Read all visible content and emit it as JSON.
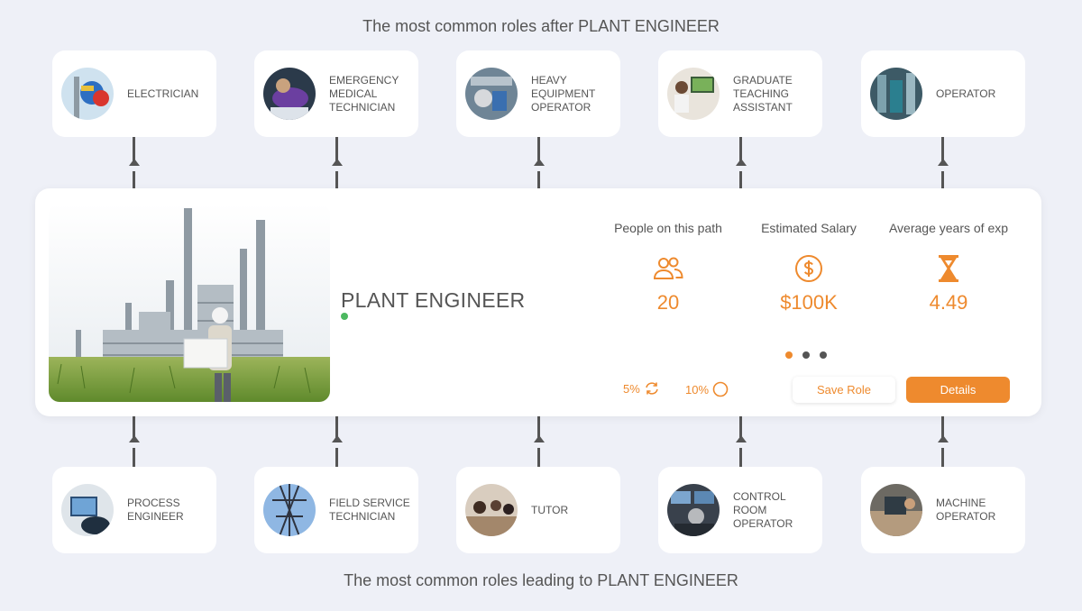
{
  "headings": {
    "after": "The most common roles after PLANT ENGINEER",
    "before": "The most common roles leading to PLANT ENGINEER"
  },
  "roles_after": [
    {
      "label": "ELECTRICIAN",
      "icon": "electrician-photo"
    },
    {
      "label": "EMERGENCY\nMEDICAL\nTECHNICIAN",
      "icon": "emt-photo"
    },
    {
      "label": "HEAVY\nEQUIPMENT\nOPERATOR",
      "icon": "heavy-equipment-photo"
    },
    {
      "label": "GRADUATE\nTEACHING\nASSISTANT",
      "icon": "teaching-photo"
    },
    {
      "label": "OPERATOR",
      "icon": "operator-photo"
    }
  ],
  "roles_before": [
    {
      "label": "PROCESS\nENGINEER",
      "icon": "process-engineer-photo"
    },
    {
      "label": "FIELD SERVICE\nTECHNICIAN",
      "icon": "field-service-photo"
    },
    {
      "label": "TUTOR",
      "icon": "tutor-photo"
    },
    {
      "label": "CONTROL\nROOM\nOPERATOR",
      "icon": "control-room-photo"
    },
    {
      "label": "MACHINE\nOPERATOR",
      "icon": "machine-operator-photo"
    }
  ],
  "main": {
    "title": "PLANT ENGINEER",
    "stats": {
      "people": {
        "label": "People on this path",
        "value": "20",
        "icon": "people-icon"
      },
      "salary": {
        "label": "Estimated Salary",
        "value": "$100K",
        "icon": "dollar-icon"
      },
      "years": {
        "label": "Average years of exp",
        "value": "4.49",
        "icon": "hourglass-icon"
      }
    },
    "trend_a": "5%",
    "trend_b": "10%",
    "save_label": "Save Role",
    "details_label": "Details"
  },
  "colors": {
    "accent": "#ee8a2e",
    "status": "#4cb860",
    "text": "#555555",
    "background": "#eef0f7"
  }
}
